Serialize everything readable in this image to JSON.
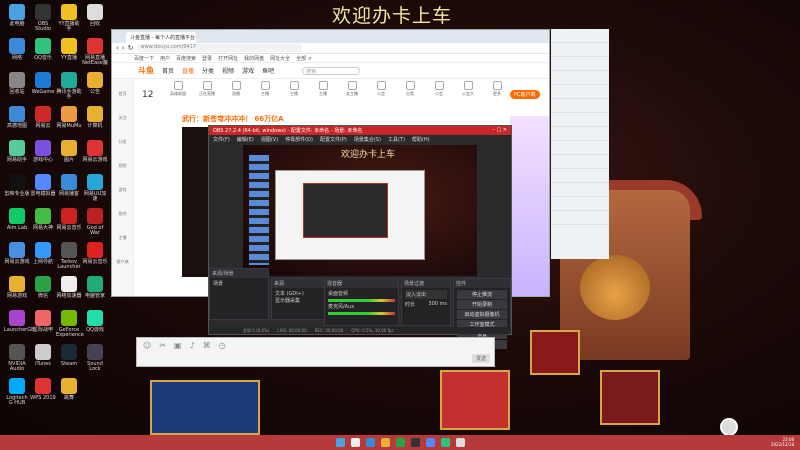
{
  "banner": "欢迎办卡上车",
  "desktop_icons": [
    {
      "label": "此电脑",
      "color": "#4aa0e0"
    },
    {
      "label": "OBS Studio",
      "color": "#333"
    },
    {
      "label": "YY直播助手",
      "color": "#f0c020"
    },
    {
      "label": "回收",
      "color": "#ddd"
    },
    {
      "label": "网络",
      "color": "#3b8ad8"
    },
    {
      "label": "QQ音乐",
      "color": "#31c27c"
    },
    {
      "label": "YY直播",
      "color": "#f0c020"
    },
    {
      "label": "网易直播 NetEase魔",
      "color": "#d33"
    },
    {
      "label": "回收站",
      "color": "#888"
    },
    {
      "label": "WeGame",
      "color": "#1f7ad6"
    },
    {
      "label": "腾讯手游助手",
      "color": "#2a9"
    },
    {
      "label": "公告",
      "color": "#e8b030"
    },
    {
      "label": "高德地图",
      "color": "#3b8ad8"
    },
    {
      "label": "网易云",
      "color": "#cc2a2a"
    },
    {
      "label": "网易MuMu",
      "color": "#e94"
    },
    {
      "label": "计算机",
      "color": "#e8b030"
    },
    {
      "label": "网易助手",
      "color": "#5c9"
    },
    {
      "label": "游戏中心",
      "color": "#7b4fe0"
    },
    {
      "label": "图片",
      "color": "#e8b030"
    },
    {
      "label": "网易云游戏",
      "color": "#d33"
    },
    {
      "label": "剪映专业版",
      "color": "#111"
    },
    {
      "label": "雷电模拟器",
      "color": "#5588ff"
    },
    {
      "label": "网易播客",
      "color": "#3b8ad8"
    },
    {
      "label": "网易UU加速",
      "color": "#2aa5d8"
    },
    {
      "label": "Aim Lab",
      "color": "#1c6"
    },
    {
      "label": "网易大神",
      "color": "#4b4"
    },
    {
      "label": "网易云音乐",
      "color": "#c22"
    },
    {
      "label": "God of War",
      "color": "#b22"
    },
    {
      "label": "网易云游戏",
      "color": "#4a90e2"
    },
    {
      "label": "上网导航",
      "color": "#39f"
    },
    {
      "label": "Tarkov Launcher",
      "color": "#555"
    },
    {
      "label": "网易云音乐",
      "color": "#d22"
    },
    {
      "label": "网易游戏",
      "color": "#e8b030"
    },
    {
      "label": "微信",
      "color": "#2ba245"
    },
    {
      "label": "网络加速器",
      "color": "#eee"
    },
    {
      "label": "电脑管家",
      "color": "#2a7"
    },
    {
      "label": "LauncherGB",
      "color": "#a4c"
    },
    {
      "label": "星际战甲",
      "color": "#e66"
    },
    {
      "label": "GeForce Experience",
      "color": "#76b900"
    },
    {
      "label": "QQ游戏",
      "color": "#2da"
    },
    {
      "label": "NVIDIA Audio",
      "color": "#555"
    },
    {
      "label": "iTunes",
      "color": "#ccc"
    },
    {
      "label": "Steam",
      "color": "#1b2838"
    },
    {
      "label": "Sound Lock",
      "color": "#445"
    },
    {
      "label": "Logitech G HUB",
      "color": "#0af"
    },
    {
      "label": "WPS 2019",
      "color": "#d33"
    },
    {
      "label": "跳舞",
      "color": "#e8b030"
    }
  ],
  "browser": {
    "tab_title": "斗鱼直播 - 每个人的直播平台",
    "address": "www.douyu.com/9417",
    "bookmarks": [
      "百度一下",
      "用户",
      "百度搜索",
      "登录",
      "打开网址",
      "我的网盘",
      "网址大全",
      "全部 >"
    ],
    "logo": "斗鱼",
    "nav": [
      "首页",
      "直播",
      "分类",
      "视频",
      "游戏",
      "鱼吧"
    ],
    "nav_active": 1,
    "search_placeholder": "搜索",
    "pc_button": "PC客户端",
    "left_items": [
      "首页",
      "关注",
      "分类",
      "视频",
      "游戏",
      "鱼吧",
      "主播",
      "客户端"
    ],
    "date_number": "12",
    "categories": [
      "英雄联盟",
      "正在直播",
      "直播",
      "主播",
      "主播",
      "主播",
      "女主播",
      "公会",
      "分类",
      "公会",
      "公会大",
      "更多"
    ],
    "stream_title": "武行：新苍穹冲冲冲！ 66万亿A"
  },
  "obs": {
    "title": "OBS 27.2.4 (64-bit, windows) - 配置文件: 未命名 - 场景: 未命名",
    "menu": [
      "文件(F)",
      "编辑(E)",
      "视图(V)",
      "停靠部件(D)",
      "配置文件(P)",
      "场景集合(S)",
      "工具(T)",
      "帮助(H)"
    ],
    "preview_banner": "欢迎办卡上车",
    "docks": {
      "scenes": {
        "title": "来源/场景",
        "items": [
          "场景"
        ]
      },
      "sources": {
        "title": "来源",
        "items": [
          "文本 (GDI+)",
          "显示器采集"
        ]
      },
      "mixer": {
        "title": "混音器",
        "items": [
          "桌面音频",
          "麦克风/Aux"
        ]
      },
      "transitions": {
        "title": "场景过渡",
        "type": "淡入淡出",
        "duration_label": "时长",
        "duration": "300 ms"
      },
      "controls": {
        "title": "控件",
        "buttons": [
          "停止推流",
          "开始录制",
          "启动虚拟摄像机",
          "工作室模式",
          "设置",
          "退出"
        ]
      }
    },
    "status": [
      "丢帧 0 (0.0%)",
      "LIVE: 00:00:00",
      "REC: 00:00:00",
      "CPU: 0.5%, 30.00 fps"
    ]
  },
  "chat": {
    "tools": [
      "☺",
      "✂",
      "▣",
      "♪",
      "⌘",
      "◷"
    ],
    "send": "发送"
  },
  "qq": {
    "rows": [
      "",
      "",
      "",
      "",
      "",
      "",
      "",
      "",
      "",
      "",
      "",
      "",
      "",
      ""
    ]
  },
  "taskbar": {
    "time": "23:08",
    "date": "2022/12/18"
  }
}
